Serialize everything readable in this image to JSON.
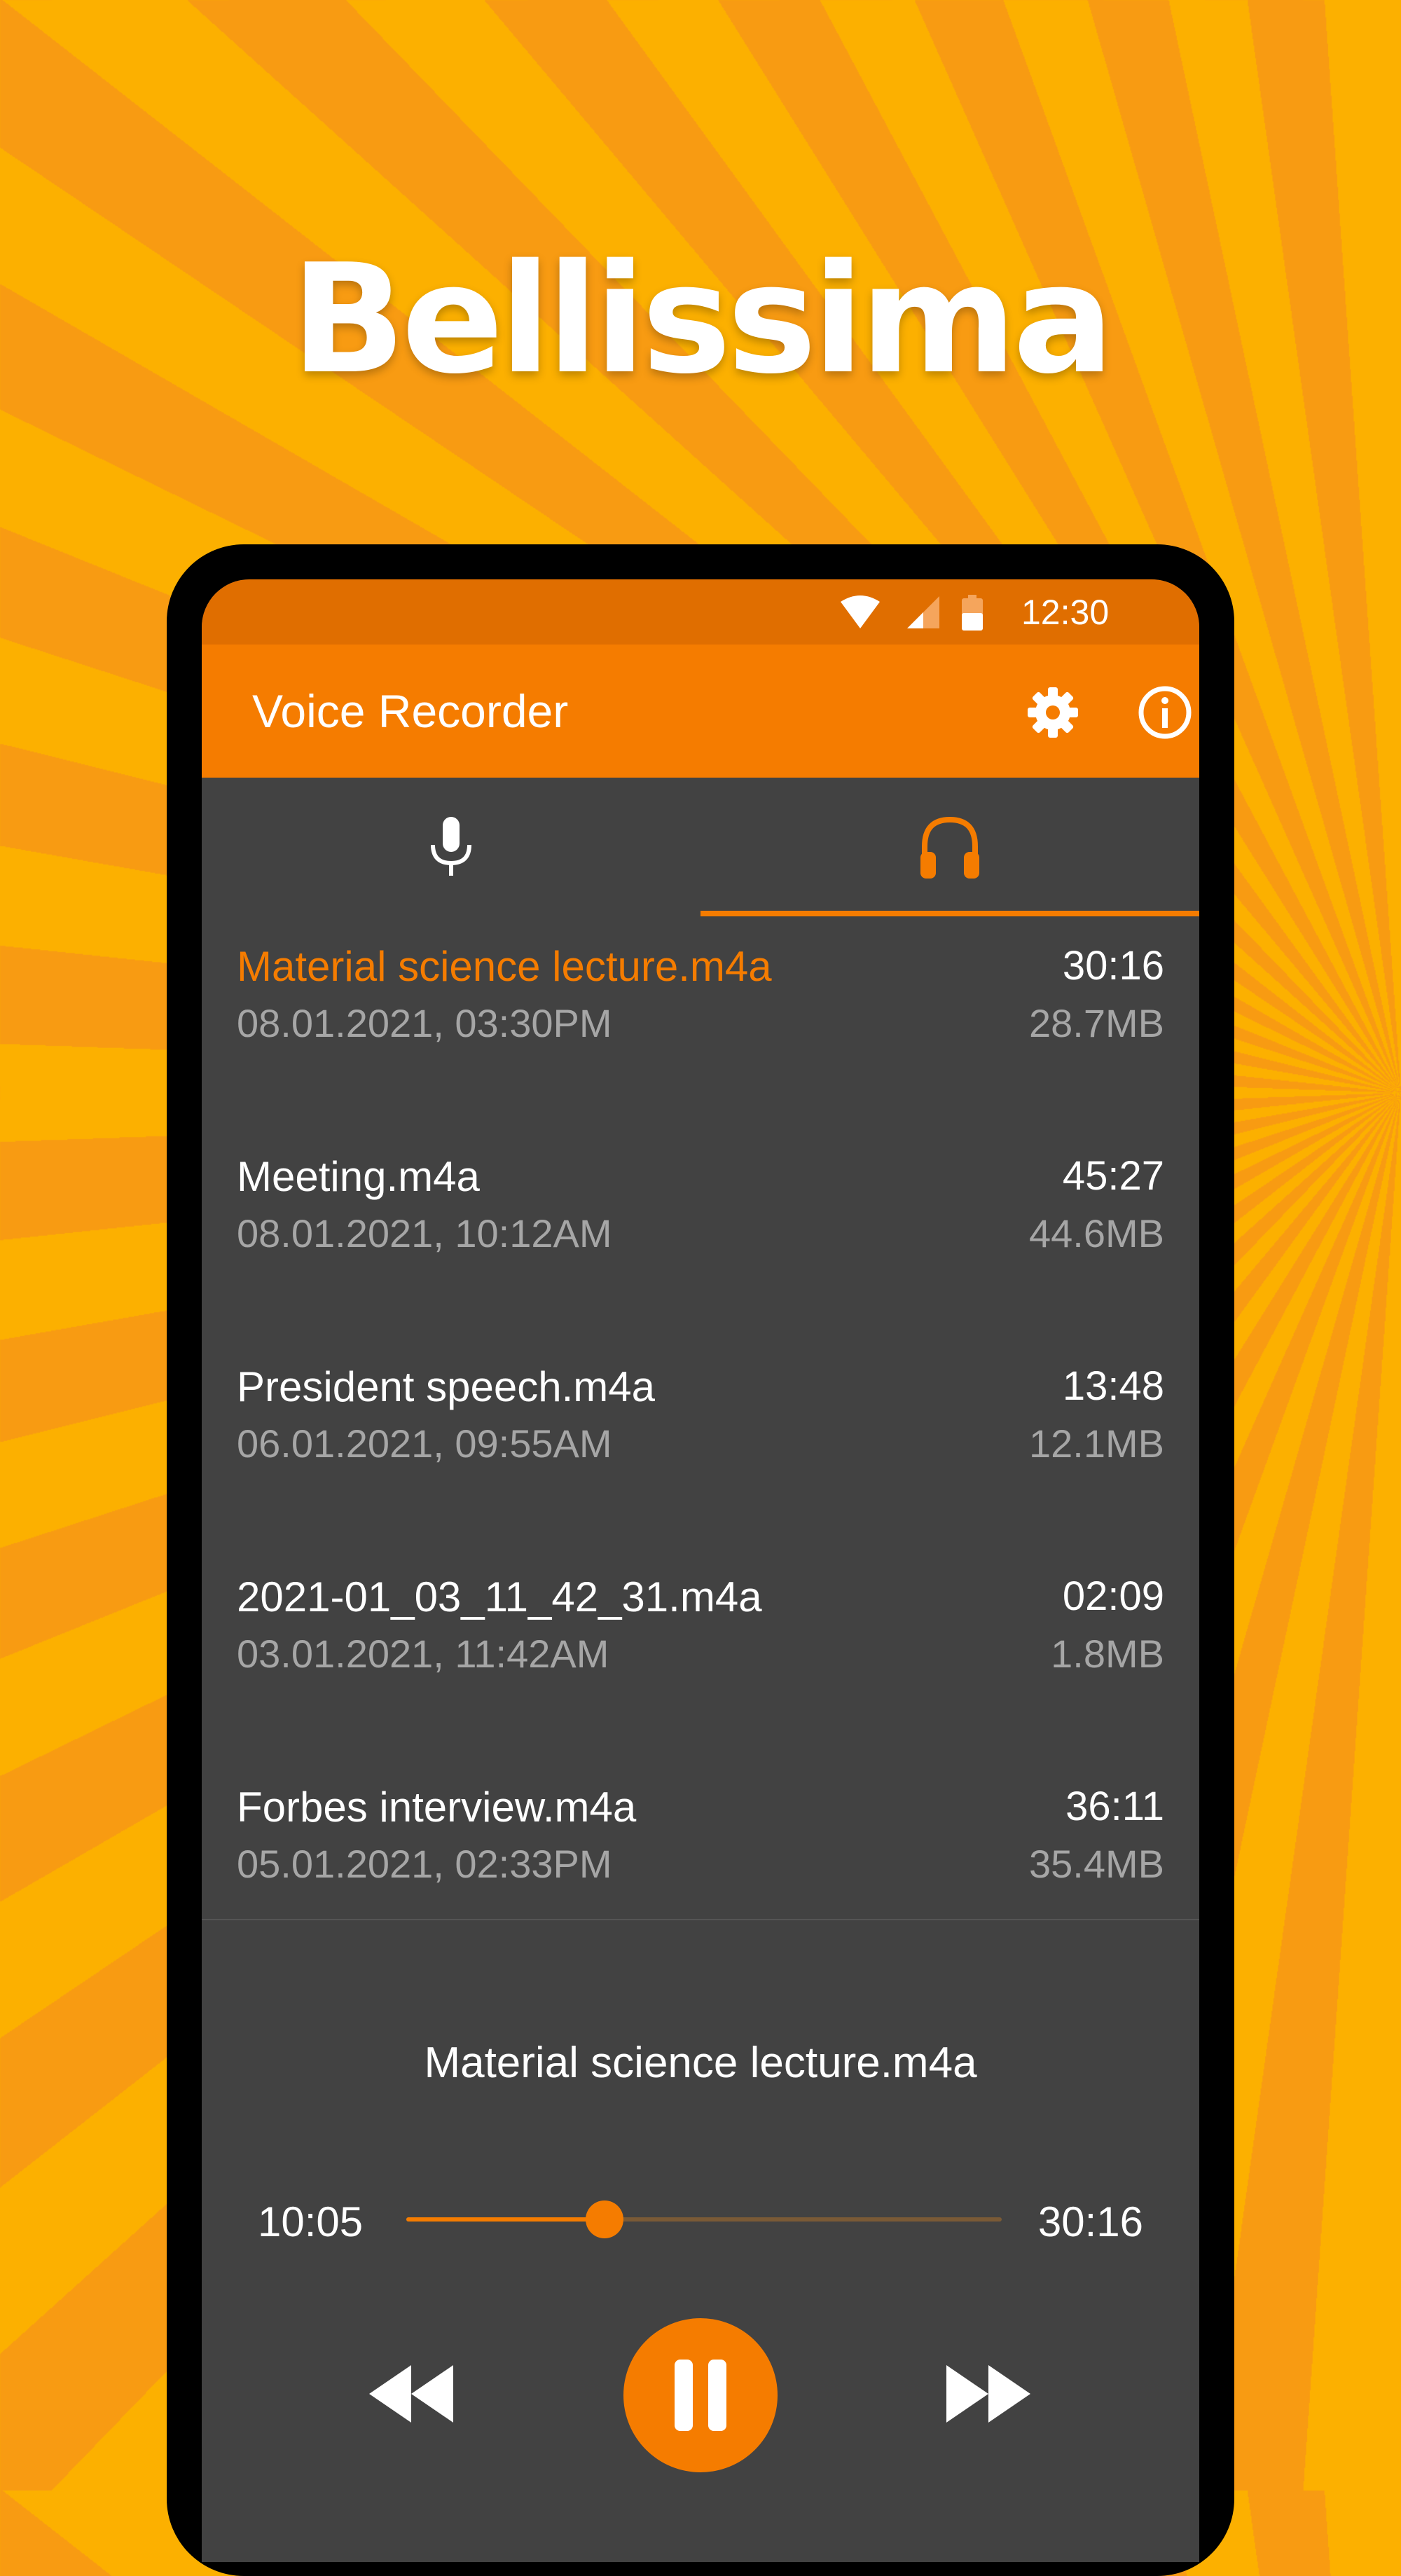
{
  "promo": {
    "headline": "Bellissima"
  },
  "status_bar": {
    "time": "12:30",
    "icons": [
      "wifi-icon",
      "signal-icon",
      "battery-icon"
    ]
  },
  "app_bar": {
    "title": "Voice Recorder",
    "actions": [
      "gear-icon",
      "info-icon"
    ]
  },
  "tabs": [
    {
      "icon": "microphone-icon",
      "selected": false
    },
    {
      "icon": "headphones-icon",
      "selected": true
    }
  ],
  "recordings": [
    {
      "name": "Material science lecture.m4a",
      "date": "08.01.2021, 03:30PM",
      "duration": "30:16",
      "size": "28.7MB",
      "active": true
    },
    {
      "name": "Meeting.m4a",
      "date": "08.01.2021, 10:12AM",
      "duration": "45:27",
      "size": "44.6MB",
      "active": false
    },
    {
      "name": "President speech.m4a",
      "date": "06.01.2021, 09:55AM",
      "duration": "13:48",
      "size": "12.1MB",
      "active": false
    },
    {
      "name": "2021-01_03_11_42_31.m4a",
      "date": "03.01.2021, 11:42AM",
      "duration": "02:09",
      "size": "1.8MB",
      "active": false
    },
    {
      "name": "Forbes interview.m4a",
      "date": "05.01.2021, 02:33PM",
      "duration": "36:11",
      "size": "35.4MB",
      "active": false
    }
  ],
  "player": {
    "title": "Material science lecture.m4a",
    "current_time": "10:05",
    "total_time": "30:16",
    "progress": 0.333,
    "controls": [
      "rewind-icon",
      "pause-icon",
      "fast-forward-icon"
    ]
  },
  "colors": {
    "accent": "#F57C00",
    "status_bar": "#E06E00",
    "surface": "#424242",
    "secondary_text": "#A6A6A6",
    "background_stripe_a": "#F89B12",
    "background_stripe_b": "#FCB000"
  }
}
